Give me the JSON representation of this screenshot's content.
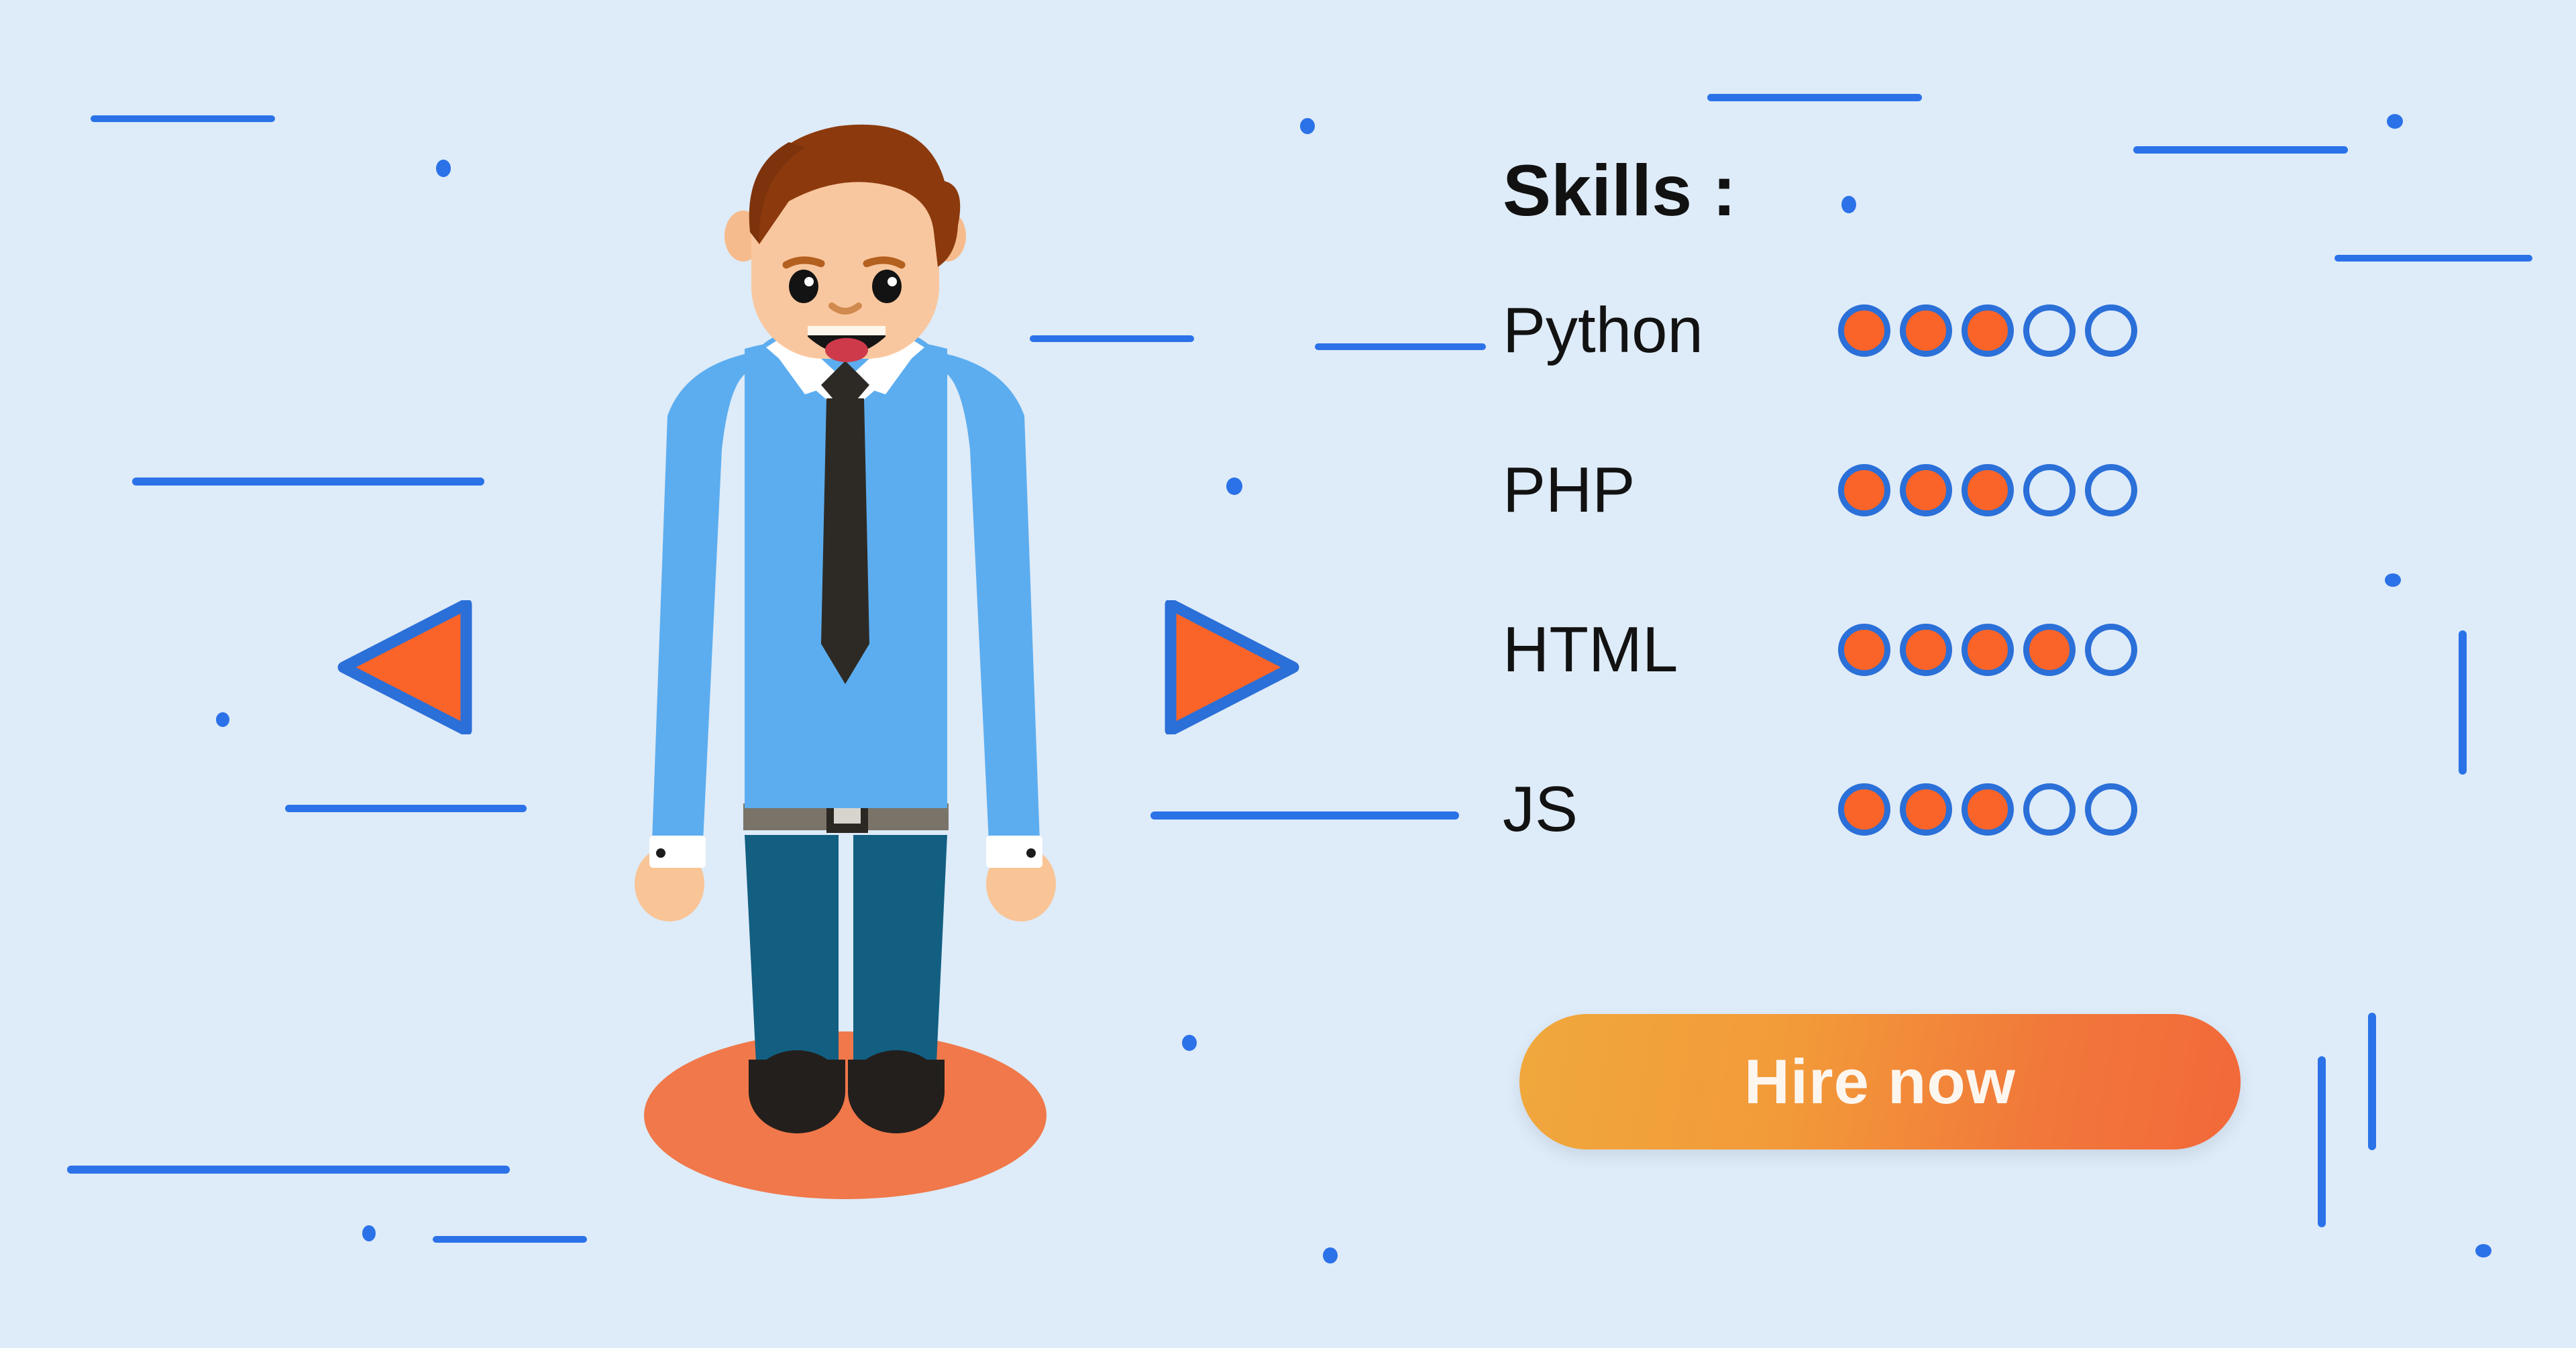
{
  "background": {
    "color": "#deebf8",
    "deco_color": "#2b72e8"
  },
  "colors": {
    "accent_orange": "#fa6428",
    "accent_blue": "#2b6fd8",
    "ground": "#f0784a",
    "shirt": "#5cadef",
    "trousers": "#125f82",
    "hair": "#8c3a0d",
    "skin": "#f7c79f",
    "tie": "#2d2a25",
    "belt": "#7a7468",
    "button_gradient_start": "#f0a83c",
    "button_gradient_end": "#f2683a"
  },
  "nav": {
    "prev": {
      "label": "prev-slide",
      "icon": "triangle-left-icon"
    },
    "next": {
      "label": "next-slide",
      "icon": "triangle-right-icon"
    }
  },
  "skills": {
    "title": "Skills :",
    "max_rating": 5,
    "items": [
      {
        "label": "Python",
        "rating": 3
      },
      {
        "label": "PHP",
        "rating": 3
      },
      {
        "label": "HTML",
        "rating": 4
      },
      {
        "label": "JS",
        "rating": 3
      }
    ]
  },
  "cta": {
    "label": "Hire now"
  },
  "character": {
    "alt": "cartoon developer in blue shirt and tie"
  }
}
